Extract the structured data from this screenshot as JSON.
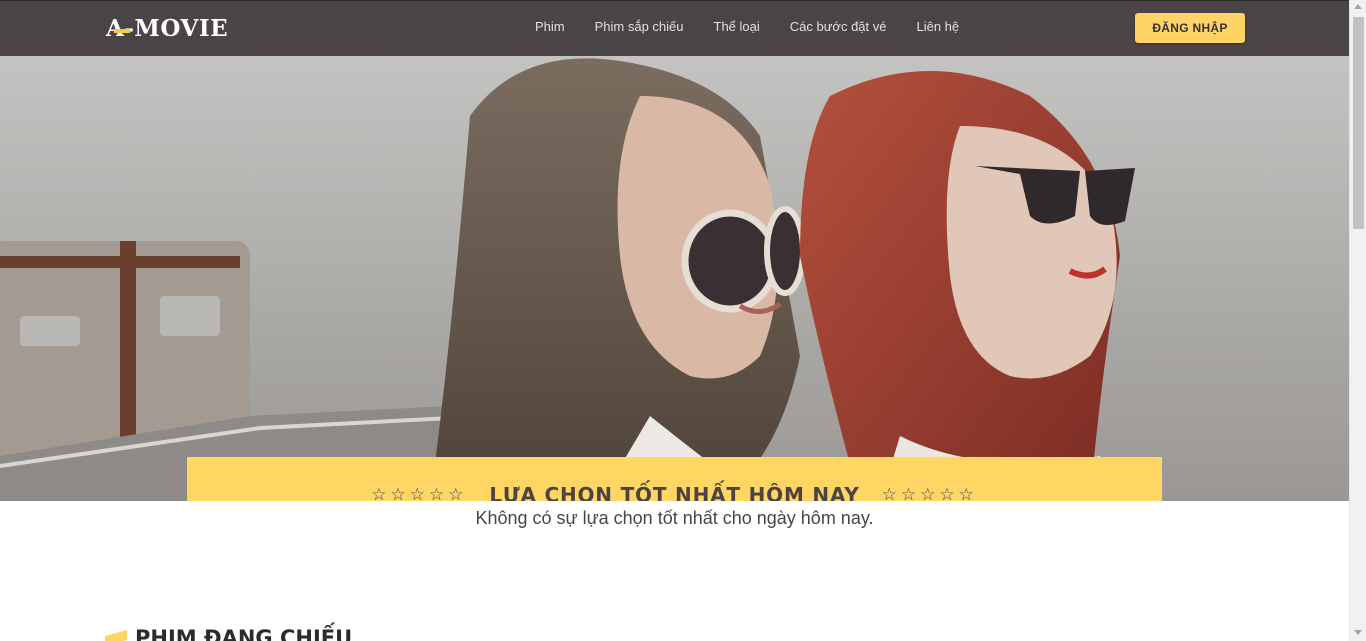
{
  "header": {
    "logo": "A-MOVIE",
    "nav": [
      "Phim",
      "Phim sắp chiếu",
      "Thể loại",
      "Các bước đặt vé",
      "Liên hệ"
    ],
    "login_label": "ĐĂNG NHẬP"
  },
  "hero": {
    "banner_title": "LỰA CHỌN TỐT NHẤT HÔM NAY",
    "stars_left": "☆☆☆☆☆",
    "stars_right": "☆☆☆☆☆",
    "subtitle": "Không có sự lựa chọn tốt nhất cho ngày hôm nay."
  },
  "section": {
    "title": "PHIM ĐANG CHIẾU"
  },
  "colors": {
    "header_bg": "#4a4446",
    "accent": "#ffd663"
  }
}
